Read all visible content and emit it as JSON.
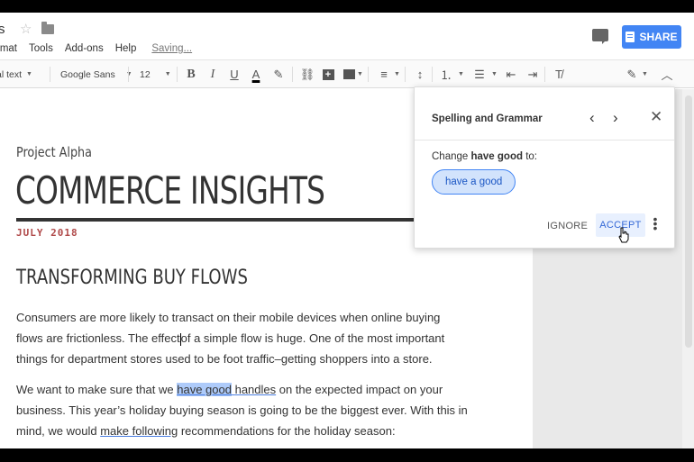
{
  "titlebar": {
    "doc_title": "s",
    "share_label": "SHARE"
  },
  "menu": {
    "items": [
      "rmat",
      "Tools",
      "Add-ons",
      "Help"
    ],
    "status": "Saving..."
  },
  "toolbar": {
    "style": "al text",
    "font": "Google Sans",
    "size": "12"
  },
  "document": {
    "project": "Project Alpha",
    "headline": "COMMERCE INSIGHTS",
    "date": "JULY 2018",
    "subhead": "TRANSFORMING BUY FLOWS",
    "p1": {
      "line1": "Consumers are more likely to transact on their mobile devices when online buying",
      "line2a": "flows are frictionless. The effect",
      "line2b": "of a simple flow is huge. One of the most important",
      "line3": "things for department stores used to be foot traffic–getting shoppers into a store."
    },
    "p2": {
      "line1a": "We want to make sure that we ",
      "line1_hl": "have good",
      "line1_space": " ",
      "line1_handles": "handles",
      "line1b": " on the expected impact on your",
      "line2": "business. This year’s holiday buying season is going to be the biggest ever. With this in",
      "line3a": "mind, we would ",
      "line3_wavy": "make following",
      "line3b": " recommendations for the holiday season:"
    }
  },
  "spelling": {
    "title": "Spelling and Grammar",
    "change_prefix": "Change ",
    "change_word": "have good",
    "change_suffix": " to:",
    "suggestion": "have a good",
    "ignore": "IGNORE",
    "accept": "ACCEPT"
  }
}
